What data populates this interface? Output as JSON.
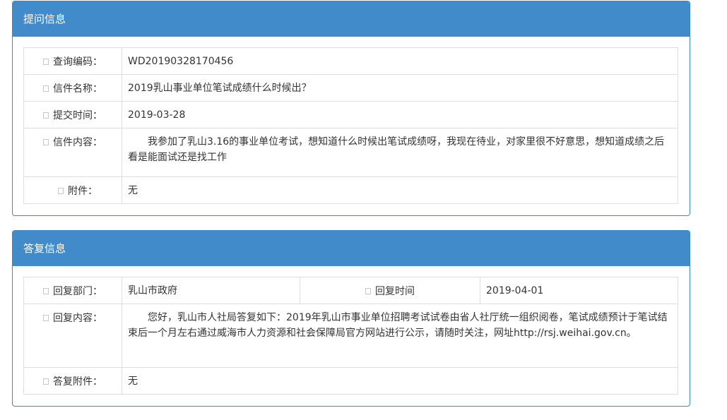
{
  "question": {
    "title": "提问信息",
    "rows": [
      {
        "label": "查询编码：",
        "value": "WD20190328170456"
      },
      {
        "label": "信件名称：",
        "value": "2019乳山事业单位笔试成绩什么时候出？"
      },
      {
        "label": "提交时间：",
        "value": "2019-03-28"
      },
      {
        "label": "信件内容：",
        "value": "我参加了乳山3.16的事业单位考试，想知道什么时候出笔试成绩呀，我现在待业，对家里很不好意思，想知道成绩之后看是能面试还是找工作"
      },
      {
        "label": "附件：",
        "value": "无"
      }
    ]
  },
  "reply": {
    "title": "答复信息",
    "dept_label": "回复部门：",
    "dept_value": "乳山市政府",
    "time_label": "回复时间",
    "time_value": "2019-04-01",
    "content_label": "回复内容：",
    "content_value": "您好，乳山市人社局答复如下：2019年乳山市事业单位招聘考试试卷由省人社厅统一组织阅卷，笔试成绩预计于笔试结束后一个月左右通过威海市人力资源和社会保障局官方网站进行公示，请随时关注，网址http://rsj.weihai.gov.cn。",
    "attach_label": "答复附件：",
    "attach_value": "无"
  }
}
